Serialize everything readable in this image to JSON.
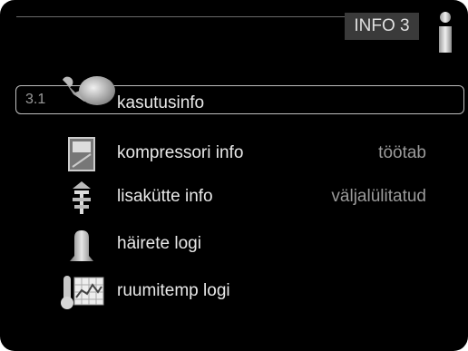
{
  "header": {
    "title": "INFO 3",
    "icon": "info-icon"
  },
  "menu": {
    "selected_number": "3.1",
    "items": [
      {
        "label": "kasutusinfo",
        "status": "",
        "icon": "wrench-icon"
      },
      {
        "label": "kompressori info",
        "status": "töötab",
        "icon": "compressor-icon"
      },
      {
        "label": "lisakütte info",
        "status": "väljalülitatud",
        "icon": "heater-icon"
      },
      {
        "label": "häirete logi",
        "status": "",
        "icon": "bell-icon"
      },
      {
        "label": "ruumitemp logi",
        "status": "",
        "icon": "thermometer-graph-icon"
      }
    ]
  },
  "colors": {
    "background": "#000000",
    "text": "#e8e8e8",
    "status": "#9a9a9a",
    "header_bg": "#3a3a3a"
  }
}
